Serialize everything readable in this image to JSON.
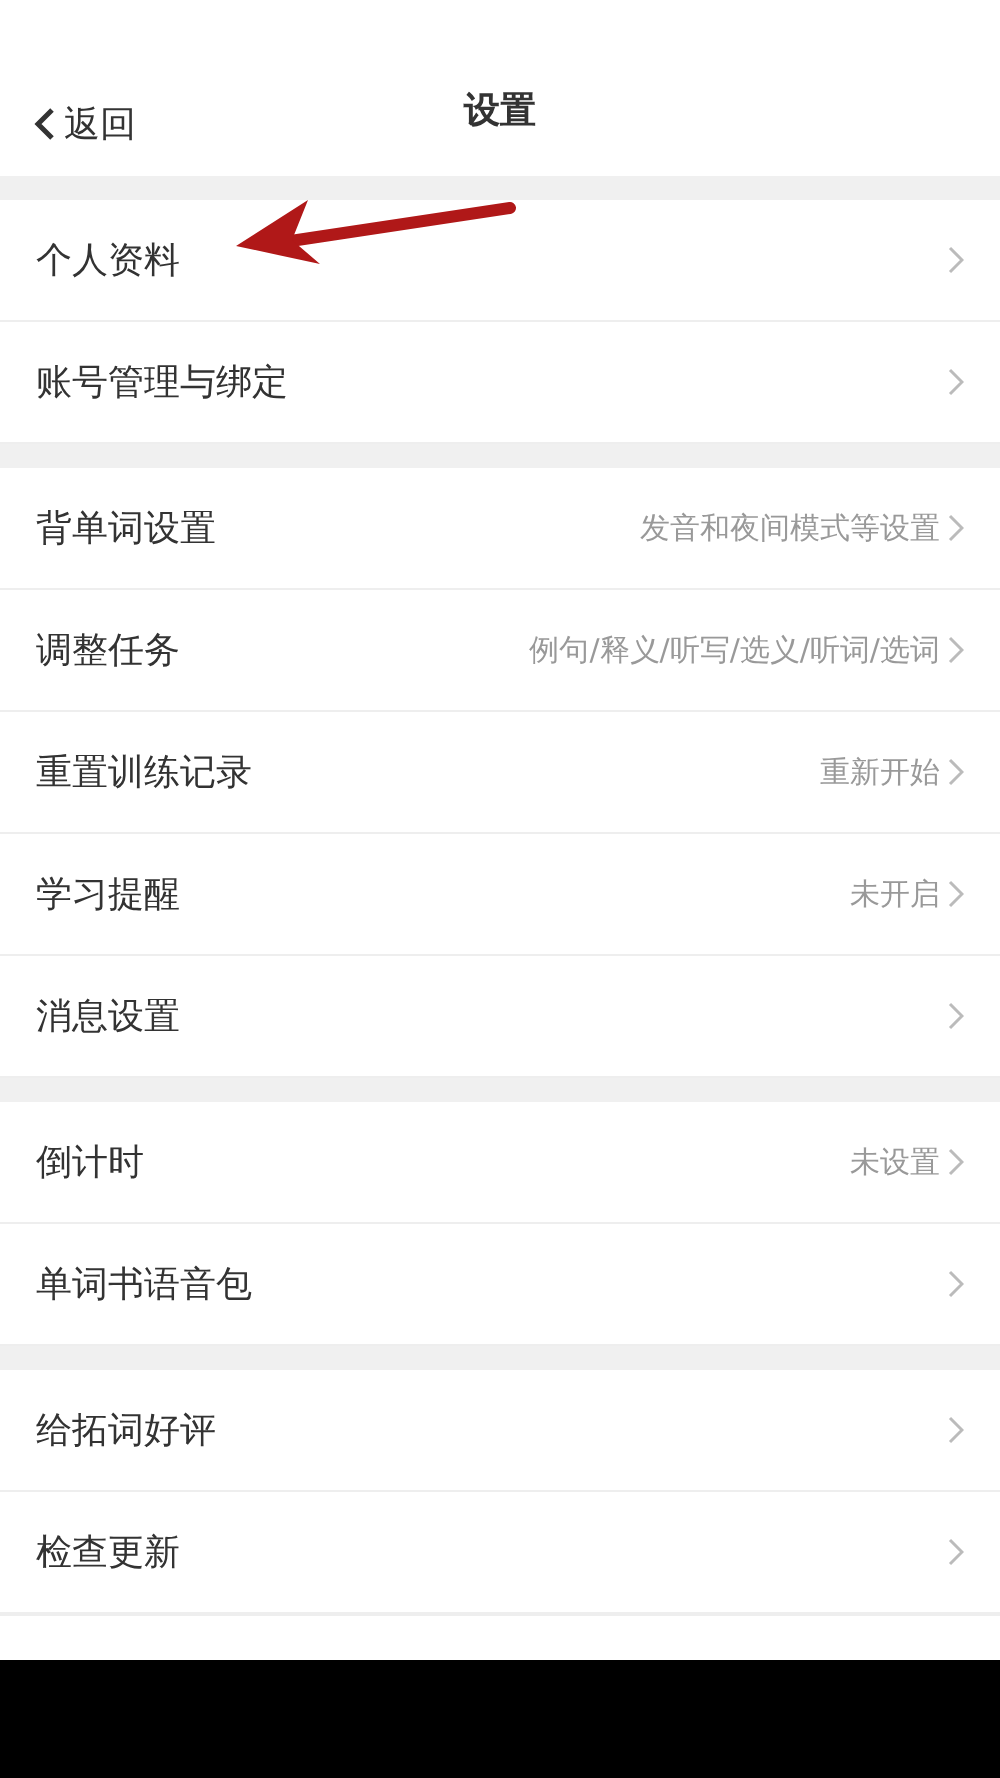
{
  "nav_bar": {
    "back": "返回",
    "title": "设置"
  },
  "sections": [
    {
      "items": [
        {
          "label": "个人资料"
        },
        {
          "label": "账号管理与绑定"
        }
      ]
    },
    {
      "items": [
        {
          "label": "背单词设置",
          "value": "发音和夜间模式等设置"
        },
        {
          "label": "调整任务",
          "value": "例句/释义/听写/选义/听词/选词"
        },
        {
          "label": "重置训练记录",
          "value": "重新开始"
        },
        {
          "label": "学习提醒",
          "value": "未开启"
        },
        {
          "label": "消息设置"
        }
      ]
    },
    {
      "items": [
        {
          "label": "倒计时",
          "value": "未设置"
        },
        {
          "label": "单词书语音包"
        }
      ]
    },
    {
      "items": [
        {
          "label": "给拓词好评"
        },
        {
          "label": "检查更新"
        }
      ]
    }
  ]
}
